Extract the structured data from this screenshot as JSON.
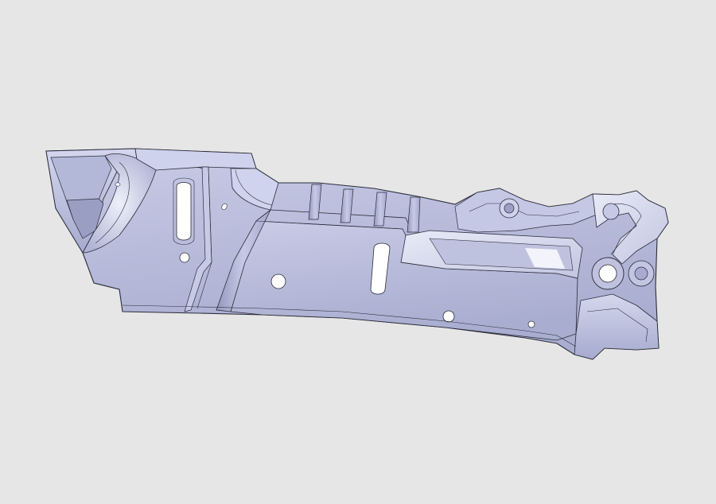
{
  "scene": {
    "background_color": "#e6e6e6",
    "part_fill_color": "#b9bcdb",
    "part_highlight_color": "#d6d9ee",
    "part_shadow_color": "#8e92b8",
    "edge_color": "#2a2c3a",
    "hole_fill_color": "#ffffff"
  }
}
